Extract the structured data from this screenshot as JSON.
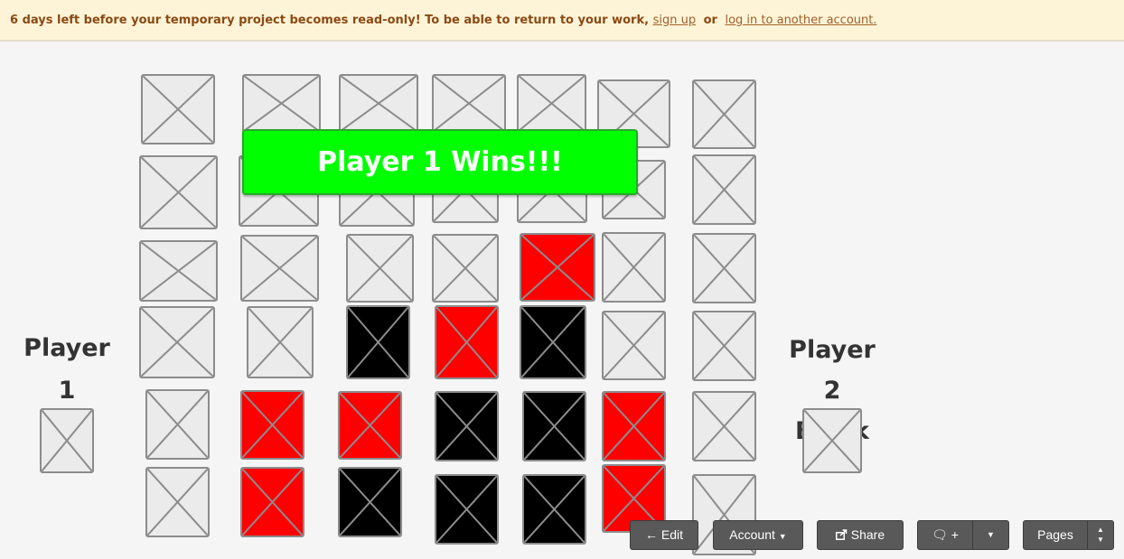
{
  "banner": {
    "message": "6 days left before your temporary project becomes read-only! To be able to return to your work,",
    "signup_link": "sign up",
    "or_text": "or",
    "login_link": "log in to another account."
  },
  "game": {
    "win_message": "Player 1 Wins!!!",
    "player1": {
      "name": "Player 1",
      "color": "Red"
    },
    "player2": {
      "name": "Player 2",
      "color": "Black"
    },
    "piece_colors": {
      "red": "#ff0000",
      "black": "#000000",
      "empty": "#ebebeb"
    },
    "board": [
      [
        "empty",
        "empty",
        "empty",
        "empty",
        "empty",
        "empty",
        "empty"
      ],
      [
        "empty",
        "empty",
        "empty",
        "empty",
        "empty",
        "empty",
        "empty"
      ],
      [
        "empty",
        "empty",
        "empty",
        "empty",
        "red",
        "empty",
        "empty"
      ],
      [
        "empty",
        "empty",
        "black",
        "red",
        "black",
        "empty",
        "empty"
      ],
      [
        "empty",
        "red",
        "red",
        "black",
        "black",
        "red",
        "empty"
      ],
      [
        "empty",
        "red",
        "black",
        "black",
        "black",
        "red",
        "empty"
      ]
    ]
  },
  "toolbar": {
    "edit": "Edit",
    "account": "Account",
    "share": "Share",
    "comment_plus": "+",
    "pages": "Pages"
  }
}
